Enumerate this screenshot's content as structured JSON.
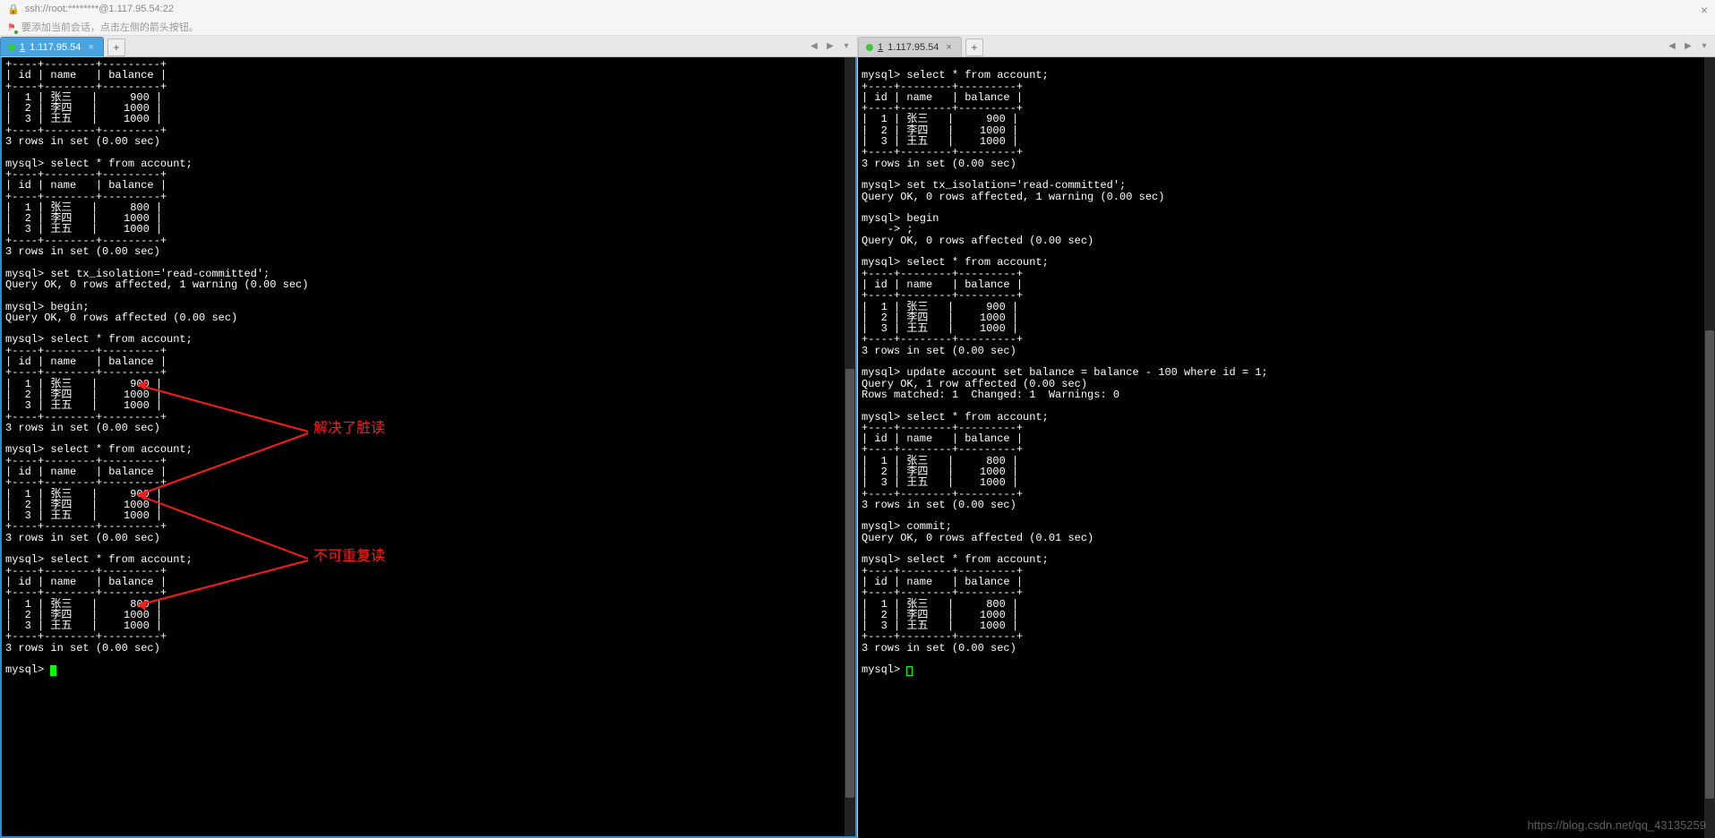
{
  "address_bar": {
    "url": "ssh://root:********@1.117.95.54:22",
    "close": "×"
  },
  "hint_bar": {
    "text": "要添加当前会话，点击左侧的箭头按钮。"
  },
  "tabs": {
    "left": {
      "num": "1",
      "host": "1.117.95.54",
      "close": "×",
      "add": "+"
    },
    "right": {
      "num": "1",
      "host": "1.117.95.54",
      "close": "×",
      "add": "+"
    },
    "nav_left": "◀",
    "nav_right": "▶",
    "nav_down": "▾"
  },
  "left_terminal": {
    "content": "+----+--------+---------+\n| id | name   | balance |\n+----+--------+---------+\n|  1 | 张三   |     900 |\n|  2 | 李四   |    1000 |\n|  3 | 王五   |    1000 |\n+----+--------+---------+\n3 rows in set (0.00 sec)\n\nmysql> select * from account;\n+----+--------+---------+\n| id | name   | balance |\n+----+--------+---------+\n|  1 | 张三   |     800 |\n|  2 | 李四   |    1000 |\n|  3 | 王五   |    1000 |\n+----+--------+---------+\n3 rows in set (0.00 sec)\n\nmysql> set tx_isolation='read-committed';\nQuery OK, 0 rows affected, 1 warning (0.00 sec)\n\nmysql> begin;\nQuery OK, 0 rows affected (0.00 sec)\n\nmysql> select * from account;\n+----+--------+---------+\n| id | name   | balance |\n+----+--------+---------+\n|  1 | 张三   |     900 |\n|  2 | 李四   |    1000 |\n|  3 | 王五   |    1000 |\n+----+--------+---------+\n3 rows in set (0.00 sec)\n\nmysql> select * from account;\n+----+--------+---------+\n| id | name   | balance |\n+----+--------+---------+\n|  1 | 张三   |     900 |\n|  2 | 李四   |    1000 |\n|  3 | 王五   |    1000 |\n+----+--------+---------+\n3 rows in set (0.00 sec)\n\nmysql> select * from account;\n+----+--------+---------+\n| id | name   | balance |\n+----+--------+---------+\n|  1 | 张三   |     800 |\n|  2 | 李四   |    1000 |\n|  3 | 王五   |    1000 |\n+----+--------+---------+\n3 rows in set (0.00 sec)\n\nmysql> "
  },
  "right_terminal": {
    "content": "\nmysql> select * from account;\n+----+--------+---------+\n| id | name   | balance |\n+----+--------+---------+\n|  1 | 张三   |     900 |\n|  2 | 李四   |    1000 |\n|  3 | 王五   |    1000 |\n+----+--------+---------+\n3 rows in set (0.00 sec)\n\nmysql> set tx_isolation='read-committed';\nQuery OK, 0 rows affected, 1 warning (0.00 sec)\n\nmysql> begin\n    -> ;\nQuery OK, 0 rows affected (0.00 sec)\n\nmysql> select * from account;\n+----+--------+---------+\n| id | name   | balance |\n+----+--------+---------+\n|  1 | 张三   |     900 |\n|  2 | 李四   |    1000 |\n|  3 | 王五   |    1000 |\n+----+--------+---------+\n3 rows in set (0.00 sec)\n\nmysql> update account set balance = balance - 100 where id = 1;\nQuery OK, 1 row affected (0.00 sec)\nRows matched: 1  Changed: 1  Warnings: 0\n\nmysql> select * from account;\n+----+--------+---------+\n| id | name   | balance |\n+----+--------+---------+\n|  1 | 张三   |     800 |\n|  2 | 李四   |    1000 |\n|  3 | 王五   |    1000 |\n+----+--------+---------+\n3 rows in set (0.00 sec)\n\nmysql> commit;\nQuery OK, 0 rows affected (0.01 sec)\n\nmysql> select * from account;\n+----+--------+---------+\n| id | name   | balance |\n+----+--------+---------+\n|  1 | 张三   |     800 |\n|  2 | 李四   |    1000 |\n|  3 | 王五   |    1000 |\n+----+--------+---------+\n3 rows in set (0.00 sec)\n\nmysql> "
  },
  "annotations": {
    "label1": "解决了脏读",
    "label2": "不可重复读"
  },
  "watermark": "https://blog.csdn.net/qq_43135259"
}
